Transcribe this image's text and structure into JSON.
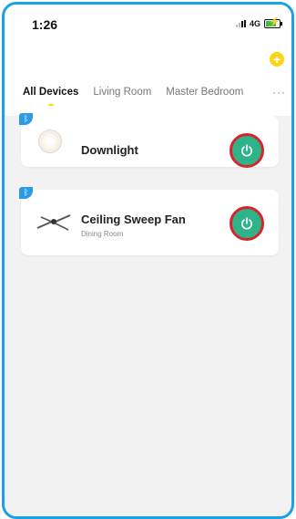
{
  "status_bar": {
    "time": "1:26",
    "network": "4G"
  },
  "header": {
    "add_icon": "plus-icon",
    "tabs": [
      {
        "label": "All Devices",
        "active": true
      },
      {
        "label": "Living Room",
        "active": false
      },
      {
        "label": "Master Bedroom",
        "active": false
      }
    ],
    "more_label": "···"
  },
  "devices": [
    {
      "name": "Downlight",
      "room": "",
      "icon": "downlight-icon",
      "connection": "bluetooth",
      "power_color": "#2fb389"
    },
    {
      "name": "Ceiling Sweep Fan",
      "room": "Dining Room",
      "icon": "ceiling-fan-icon",
      "connection": "bluetooth",
      "power_color": "#2fb389"
    }
  ],
  "colors": {
    "accent": "#f8d617",
    "frame": "#1aa3e4",
    "power": "#2fb389",
    "highlight": "#d62530",
    "bluetooth": "#2b9be7"
  }
}
